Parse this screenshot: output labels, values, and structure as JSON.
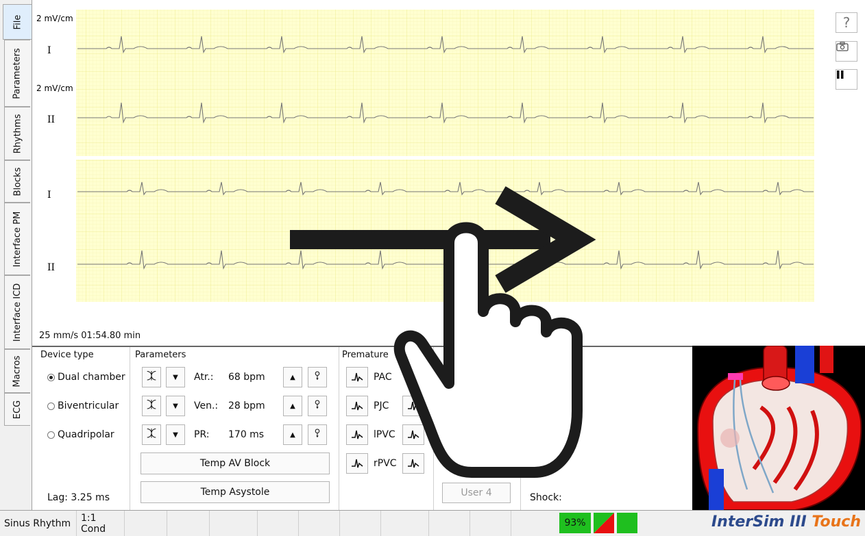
{
  "tabs": [
    "File",
    "Parameters",
    "Rhythms",
    "Blocks",
    "Interface PM",
    "Interface ICD",
    "Macros",
    "ECG"
  ],
  "ecg": {
    "leads": [
      {
        "gain": "2 mV/cm",
        "label": "I"
      },
      {
        "gain": "2 mV/cm",
        "label": "II"
      },
      {
        "gain": "",
        "label": "I"
      },
      {
        "gain": "",
        "label": "II"
      }
    ],
    "timebase": "25 mm/s  01:54.80 min",
    "help_label": "?"
  },
  "device": {
    "title": "Device type",
    "options": [
      {
        "label": "Dual chamber",
        "selected": true
      },
      {
        "label": "Biventricular",
        "selected": false
      },
      {
        "label": "Quadripolar",
        "selected": false
      }
    ],
    "lag": "Lag:  3.25 ms"
  },
  "parameters": {
    "title": "Parameters",
    "rows": [
      {
        "label": "Atr.:",
        "value": "68 bpm"
      },
      {
        "label": "Ven.:",
        "value": "28 bpm"
      },
      {
        "label": "PR:",
        "value": "170 ms"
      }
    ],
    "temp_av_block": "Temp AV Block",
    "temp_asystole": "Temp Asystole"
  },
  "premature": {
    "title": "Premature",
    "items": [
      "PAC",
      "PJC",
      "lPVC",
      "rPVC"
    ]
  },
  "user4": "User 4",
  "shock": "Shock:",
  "status": {
    "rhythm": "Sinus Rhythm",
    "conduction": "1:1 Cond",
    "battery": "93%",
    "brand_a": "InterSim III ",
    "brand_b": "Touch"
  },
  "colors": {
    "grid_bg": "#ffffd0",
    "grid_line": "#f0ee9a",
    "trace": "#777777",
    "brand_blue": "#2c4a8c",
    "brand_orange": "#e8741a",
    "battery_green": "#1fbf1f"
  }
}
